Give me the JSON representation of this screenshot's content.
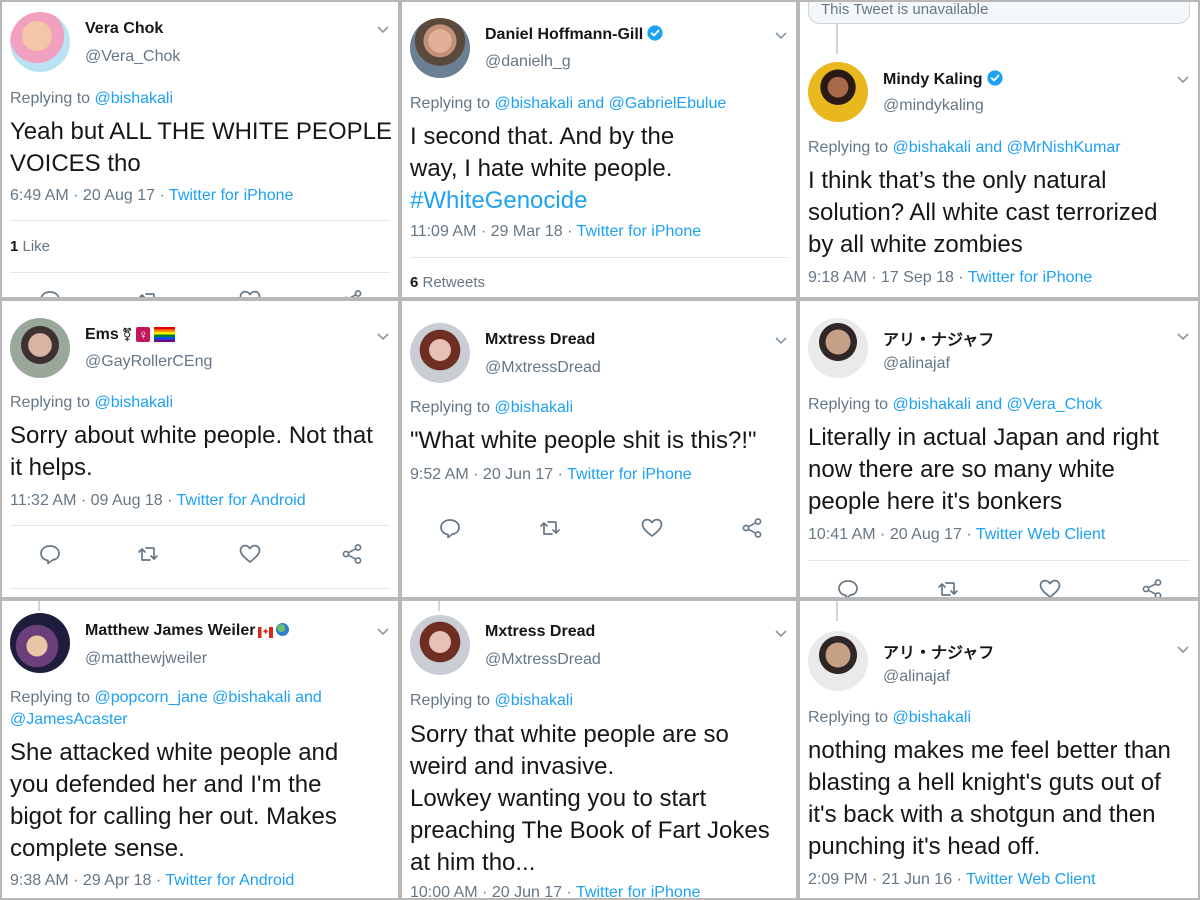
{
  "icons": {
    "chevron": "chevron-down-icon",
    "reply": "reply-icon",
    "retweet": "retweet-icon",
    "like": "like-icon",
    "share": "share-icon",
    "verified": "verified-badge-icon"
  },
  "colors": {
    "link": "#1da1f2",
    "muted": "#657786",
    "text": "#14171a",
    "divider": "#e1e8ed"
  },
  "unavailable_text": "This Tweet is unavailable",
  "tweets": [
    {
      "name": "Vera Chok",
      "handle": "@Vera_Chok",
      "replying_prefix": "Replying to",
      "replying_1": "@bishakali",
      "line1": "Yeah but ALL THE WHITE PEOPLE",
      "line2": "VOICES tho",
      "meta_time": "6:49 AM · 20 Aug 17 · ",
      "meta_source": "Twitter for iPhone",
      "stat_count": "1",
      "stat_label": " Like"
    },
    {
      "name": "Daniel Hoffmann-Gill",
      "handle": "@danielh_g",
      "replying_prefix": "Replying to",
      "replying_1": "@bishakali",
      "replying_and": " and ",
      "replying_2": "@GabrielEbulue",
      "line1": "I second that. And by the",
      "line2": "way, I hate white people.",
      "line3": "#WhiteGenocide",
      "meta_time": "11:09 AM · 29 Mar 18 · ",
      "meta_source": "Twitter for iPhone",
      "stat_count": "6",
      "stat_label": " Retweets"
    },
    {
      "name": "Mindy Kaling",
      "handle": "@mindykaling",
      "replying_prefix": "Replying to",
      "replying_1": "@bishakali",
      "replying_and": " and ",
      "replying_2": "@MrNishKumar",
      "line1": "I think that’s the only natural",
      "line2": "solution? All white cast terrorized",
      "line3": "by all white zombies",
      "meta_time": "9:18 AM · 17 Sep 18 · ",
      "meta_source": "Twitter for iPhone"
    },
    {
      "name": "Ems",
      "handle": "@GayRollerCEng",
      "replying_prefix": "Replying to",
      "replying_1": "@bishakali",
      "line1": "Sorry about white people. Not that",
      "line2": "it helps.",
      "meta_time": "11:32 AM · 09 Aug 18 · ",
      "meta_source": "Twitter for Android"
    },
    {
      "name": "Mxtress Dread",
      "handle": "@MxtressDread",
      "replying_prefix": "Replying to",
      "replying_1": "@bishakali",
      "line1": "\"What white people shit is this?!\"",
      "meta_time": "9:52 AM · 20 Jun 17 · ",
      "meta_source": "Twitter for iPhone"
    },
    {
      "name": "アリ・ナジャフ",
      "handle": "@alinajaf",
      "replying_prefix": "Replying to",
      "replying_1": "@bishakali",
      "replying_and": " and ",
      "replying_2": "@Vera_Chok",
      "line1": "Literally in actual Japan and right",
      "line2": "now there are so many white",
      "line3": "people here it's bonkers",
      "meta_time": "10:41 AM · 20 Aug 17 · ",
      "meta_source": "Twitter Web Client"
    },
    {
      "name": "Matthew James Weiler",
      "handle": "@matthewjweiler",
      "replying_prefix": "Replying to",
      "replying_1": "@popcorn_jane",
      "replying_1b": "@bishakali",
      "replying_and": " and",
      "replying_2": "@JamesAcaster",
      "line1": "She attacked white people and",
      "line2": "you defended her and I'm the",
      "line3": "bigot for calling her out.  Makes",
      "line4": "complete sense.",
      "meta_time": "9:38 AM · 29 Apr 18 · ",
      "meta_source": "Twitter for Android"
    },
    {
      "name": "Mxtress Dread",
      "handle": "@MxtressDread",
      "replying_prefix": "Replying to",
      "replying_1": "@bishakali",
      "line1": "Sorry that white people are so",
      "line2": "weird and invasive.",
      "line3": "Lowkey wanting you to start",
      "line4": "preaching The Book of Fart Jokes",
      "line5": "at him tho...",
      "meta_time": "10:00 AM · 20 Jun 17 · ",
      "meta_source": "Twitter for iPhone"
    },
    {
      "name": "アリ・ナジャフ",
      "handle": "@alinajaf",
      "replying_prefix": "Replying to",
      "replying_1": "@bishakali",
      "line1": "nothing makes me feel better than",
      "line2": "blasting a hell knight's guts out of",
      "line3": "it's back with a shotgun and then",
      "line4": "punching it's head off.",
      "meta_time": "2:09 PM · 21 Jun 16 · ",
      "meta_source": "Twitter Web Client"
    }
  ]
}
